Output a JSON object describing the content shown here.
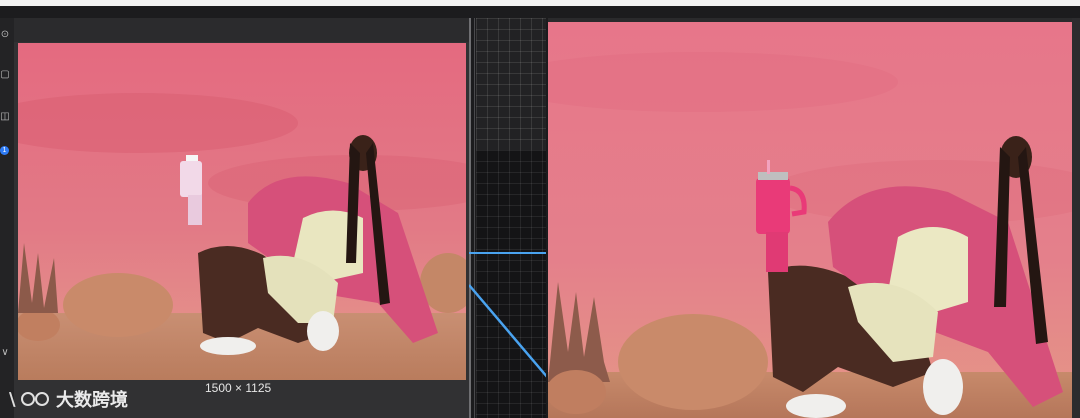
{
  "image_info": {
    "dimensions": "1500 × 1125"
  },
  "watermark": {
    "text": "大数跨境"
  },
  "toolbar": {
    "tools": [
      {
        "name": "tool-1-icon",
        "glyph": "⊙"
      },
      {
        "name": "tool-2-icon",
        "glyph": "▢"
      },
      {
        "name": "tool-3-icon",
        "glyph": "◫"
      },
      {
        "name": "layer-badge",
        "glyph": "1"
      },
      {
        "name": "tool-5-icon",
        "glyph": "∨"
      }
    ]
  },
  "colors": {
    "accent_line": "#4aa3f0",
    "panel": "#313133",
    "background": "#2a2a2c"
  }
}
